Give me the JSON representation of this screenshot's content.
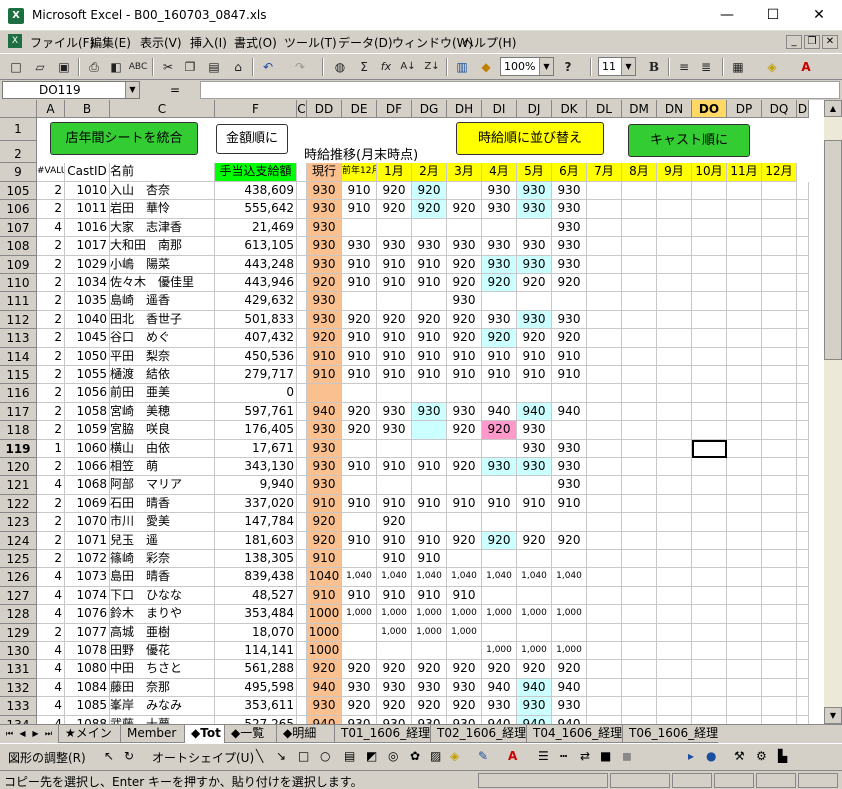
{
  "window": {
    "title": "Microsoft Excel - B00_160703_0847.xls",
    "minimize": "—",
    "maximize": "☐",
    "close": "✕",
    "app_icon": "X"
  },
  "menu": [
    "ファイル(F)",
    "編集(E)",
    "表示(V)",
    "挿入(I)",
    "書式(O)",
    "ツール(T)",
    "データ(D)",
    "ウィンドウ(W)",
    "ヘルプ(H)"
  ],
  "mdi": {
    "min": "_",
    "restore": "❐",
    "close": "✕"
  },
  "toolbar": {
    "zoom": "100%",
    "font_size": "11",
    "bold": "B",
    "icons": [
      "new-icon",
      "open-icon",
      "save-icon",
      "print-icon",
      "preview-icon",
      "spell-icon",
      "cut-icon",
      "copy-icon",
      "paste-icon",
      "format-painter-icon",
      "undo-icon",
      "redo-icon",
      "hyperlink-icon",
      "autosum-icon",
      "function-icon",
      "sort-asc-icon",
      "sort-desc-icon",
      "chart-icon",
      "drawing-icon",
      "help-icon",
      "align-center-icon",
      "align-right-icon",
      "borders-icon",
      "fill-color-icon",
      "font-color-icon"
    ],
    "sum_glyph": "Σ",
    "fx_glyph": "fx",
    "az_glyph": "A↓",
    "za_glyph": "Z↓",
    "help_glyph": "?",
    "font_color_glyph": "A"
  },
  "formula_bar": {
    "name_box": "DO119",
    "fx": "=",
    "value": ""
  },
  "columns": [
    {
      "id": "A",
      "label": "A",
      "w": 28
    },
    {
      "id": "B",
      "label": "B",
      "w": 45
    },
    {
      "id": "C",
      "label": "C",
      "w": 105
    },
    {
      "id": "F",
      "label": "F",
      "w": 82
    },
    {
      "id": "C2",
      "label": "C",
      "w": 10
    },
    {
      "id": "DD",
      "label": "DD",
      "w": 35
    },
    {
      "id": "DE",
      "label": "DE",
      "w": 35
    },
    {
      "id": "DF",
      "label": "DF",
      "w": 35
    },
    {
      "id": "DG",
      "label": "DG",
      "w": 35
    },
    {
      "id": "DH",
      "label": "DH",
      "w": 35
    },
    {
      "id": "DI",
      "label": "DI",
      "w": 35
    },
    {
      "id": "DJ",
      "label": "DJ",
      "w": 35
    },
    {
      "id": "DK",
      "label": "DK",
      "w": 35
    },
    {
      "id": "DL",
      "label": "DL",
      "w": 35
    },
    {
      "id": "DM",
      "label": "DM",
      "w": 35
    },
    {
      "id": "DN",
      "label": "DN",
      "w": 35
    },
    {
      "id": "DO",
      "label": "DO",
      "w": 35
    },
    {
      "id": "DP",
      "label": "DP",
      "w": 35
    },
    {
      "id": "DQ",
      "label": "DQ",
      "w": 35
    },
    {
      "id": "DR",
      "label": "D",
      "w": 12
    }
  ],
  "buttons": {
    "merge": "店年間シートを統合",
    "amount_order": "金額順に",
    "wage_order": "時給順に並び替え",
    "cast_order": "キャスト順に"
  },
  "header_rows": {
    "row1": "1",
    "row2": "2",
    "row9": "9",
    "title": "時給推移(月末時点)",
    "value_tag": "#VALUE!",
    "cast_id": "CastID",
    "name": "名前",
    "allowance": "手当込支給額",
    "current": "現行",
    "prev_dec": "前年12月",
    "months": [
      "1月",
      "2月",
      "3月",
      "4月",
      "5月",
      "6月",
      "7月",
      "8月",
      "9月",
      "10月",
      "11月",
      "12月"
    ]
  },
  "rows": [
    {
      "n": "105",
      "a": "2",
      "b": "1010",
      "c": "入山　杏奈",
      "f": "438,609",
      "dd": "930",
      "m": [
        "910",
        "920",
        "920",
        "",
        "930",
        "930",
        "930"
      ],
      "hl": [
        2,
        5
      ]
    },
    {
      "n": "106",
      "a": "2",
      "b": "1011",
      "c": "岩田　華怜",
      "f": "555,642",
      "dd": "930",
      "m": [
        "910",
        "920",
        "920",
        "920",
        "930",
        "930",
        "930"
      ],
      "hl": [
        2,
        5
      ]
    },
    {
      "n": "107",
      "a": "4",
      "b": "1016",
      "c": "大家　志津香",
      "f": "21,469",
      "dd": "930",
      "m": [
        "",
        "",
        "",
        "",
        "",
        "",
        "930"
      ],
      "hl": []
    },
    {
      "n": "108",
      "a": "2",
      "b": "1017",
      "c": "大和田　南那",
      "f": "613,105",
      "dd": "930",
      "m": [
        "930",
        "930",
        "930",
        "930",
        "930",
        "930",
        "930"
      ],
      "hl": []
    },
    {
      "n": "109",
      "a": "2",
      "b": "1029",
      "c": "小嶋　陽菜",
      "f": "443,248",
      "dd": "930",
      "m": [
        "910",
        "910",
        "910",
        "920",
        "930",
        "930",
        "930"
      ],
      "hl": [
        4,
        5
      ]
    },
    {
      "n": "110",
      "a": "2",
      "b": "1034",
      "c": "佐々木　優佳里",
      "f": "443,946",
      "dd": "920",
      "m": [
        "910",
        "910",
        "910",
        "920",
        "920",
        "920",
        "920"
      ],
      "hl": [
        4
      ]
    },
    {
      "n": "111",
      "a": "2",
      "b": "1035",
      "c": "島崎　遥香",
      "f": "429,632",
      "dd": "930",
      "m": [
        "",
        "",
        "",
        "930",
        "",
        "",
        ""
      ],
      "hl": []
    },
    {
      "n": "112",
      "a": "2",
      "b": "1040",
      "c": "田北　香世子",
      "f": "501,833",
      "dd": "930",
      "m": [
        "920",
        "920",
        "920",
        "920",
        "930",
        "930",
        "930"
      ],
      "hl": [
        5
      ]
    },
    {
      "n": "113",
      "a": "2",
      "b": "1045",
      "c": "谷口　めぐ",
      "f": "407,432",
      "dd": "920",
      "m": [
        "910",
        "910",
        "910",
        "920",
        "920",
        "920",
        "920"
      ],
      "hl": [
        4
      ]
    },
    {
      "n": "114",
      "a": "2",
      "b": "1050",
      "c": "平田　梨奈",
      "f": "450,536",
      "dd": "910",
      "m": [
        "910",
        "910",
        "910",
        "910",
        "910",
        "910",
        "910"
      ],
      "hl": []
    },
    {
      "n": "115",
      "a": "2",
      "b": "1055",
      "c": "樋渡　結依",
      "f": "279,717",
      "dd": "910",
      "m": [
        "910",
        "910",
        "910",
        "910",
        "910",
        "910",
        "910"
      ],
      "hl": []
    },
    {
      "n": "116",
      "a": "2",
      "b": "1056",
      "c": "前田　亜美",
      "f": "0",
      "dd": "",
      "m": [
        "",
        "",
        "",
        "",
        "",
        "",
        ""
      ],
      "hl": []
    },
    {
      "n": "117",
      "a": "2",
      "b": "1058",
      "c": "宮崎　美穂",
      "f": "597,761",
      "dd": "940",
      "m": [
        "920",
        "930",
        "930",
        "930",
        "940",
        "940",
        "940"
      ],
      "hl": [
        2,
        5
      ]
    },
    {
      "n": "118",
      "a": "2",
      "b": "1059",
      "c": "宮脇　咲良",
      "f": "176,405",
      "dd": "930",
      "m": [
        "920",
        "930",
        "",
        "920",
        "920",
        "930",
        ""
      ],
      "hl": [
        2
      ],
      "pink": [
        4
      ]
    },
    {
      "n": "119",
      "a": "1",
      "b": "1060",
      "c": "横山　由依",
      "f": "17,671",
      "dd": "930",
      "m": [
        "",
        "",
        "",
        "",
        "",
        "930",
        "930"
      ],
      "hl": []
    },
    {
      "n": "120",
      "a": "2",
      "b": "1066",
      "c": "相笠　萌",
      "f": "343,130",
      "dd": "930",
      "m": [
        "910",
        "910",
        "910",
        "920",
        "930",
        "930",
        "930"
      ],
      "hl": [
        4,
        5
      ]
    },
    {
      "n": "121",
      "a": "4",
      "b": "1068",
      "c": "阿部　マリア",
      "f": "9,940",
      "dd": "930",
      "m": [
        "",
        "",
        "",
        "",
        "",
        "",
        "930"
      ],
      "hl": []
    },
    {
      "n": "122",
      "a": "2",
      "b": "1069",
      "c": "石田　晴香",
      "f": "337,020",
      "dd": "910",
      "m": [
        "910",
        "910",
        "910",
        "910",
        "910",
        "910",
        "910"
      ],
      "hl": []
    },
    {
      "n": "123",
      "a": "2",
      "b": "1070",
      "c": "市川　愛美",
      "f": "147,784",
      "dd": "920",
      "m": [
        "",
        "920",
        "",
        "",
        "",
        "",
        ""
      ],
      "hl": []
    },
    {
      "n": "124",
      "a": "2",
      "b": "1071",
      "c": "兒玉　遥",
      "f": "181,603",
      "dd": "920",
      "m": [
        "910",
        "910",
        "910",
        "920",
        "920",
        "920",
        "920"
      ],
      "hl": [
        4
      ]
    },
    {
      "n": "125",
      "a": "2",
      "b": "1072",
      "c": "篠崎　彩奈",
      "f": "138,305",
      "dd": "910",
      "m": [
        "",
        "910",
        "910",
        "",
        "",
        "",
        ""
      ],
      "hl": []
    },
    {
      "n": "126",
      "a": "4",
      "b": "1073",
      "c": "島田　晴香",
      "f": "839,438",
      "dd": "1040",
      "m": [
        "1,040",
        "1,040",
        "1,040",
        "1,040",
        "1,040",
        "1,040",
        "1,040"
      ],
      "hl": [],
      "small": true
    },
    {
      "n": "127",
      "a": "4",
      "b": "1074",
      "c": "下口　ひなな",
      "f": "48,527",
      "dd": "910",
      "m": [
        "910",
        "910",
        "910",
        "910",
        "",
        "",
        ""
      ],
      "hl": []
    },
    {
      "n": "128",
      "a": "4",
      "b": "1076",
      "c": "鈴木　まりや",
      "f": "353,484",
      "dd": "1000",
      "m": [
        "1,000",
        "1,000",
        "1,000",
        "1,000",
        "1,000",
        "1,000",
        "1,000"
      ],
      "hl": [],
      "small": true
    },
    {
      "n": "129",
      "a": "2",
      "b": "1077",
      "c": "高城　亜樹",
      "f": "18,070",
      "dd": "1000",
      "m": [
        "",
        "1,000",
        "1,000",
        "1,000",
        "",
        "",
        ""
      ],
      "hl": [],
      "small": true
    },
    {
      "n": "130",
      "a": "4",
      "b": "1078",
      "c": "田野　優花",
      "f": "114,141",
      "dd": "1000",
      "m": [
        "",
        "",
        "",
        "",
        "1,000",
        "1,000",
        "1,000"
      ],
      "hl": [],
      "small": true
    },
    {
      "n": "131",
      "a": "4",
      "b": "1080",
      "c": "中田　ちさと",
      "f": "561,288",
      "dd": "920",
      "m": [
        "920",
        "920",
        "920",
        "920",
        "920",
        "920",
        "920"
      ],
      "hl": []
    },
    {
      "n": "132",
      "a": "4",
      "b": "1084",
      "c": "藤田　奈那",
      "f": "495,598",
      "dd": "940",
      "m": [
        "930",
        "930",
        "930",
        "930",
        "940",
        "940",
        "940"
      ],
      "hl": [
        5
      ]
    },
    {
      "n": "133",
      "a": "4",
      "b": "1085",
      "c": "峯岸　みなみ",
      "f": "353,611",
      "dd": "930",
      "m": [
        "920",
        "920",
        "920",
        "920",
        "930",
        "930",
        "930"
      ],
      "hl": [
        5
      ]
    },
    {
      "n": "134",
      "a": "4",
      "b": "1088",
      "c": "武藤　十夢",
      "f": "527,265",
      "dd": "940",
      "m": [
        "930",
        "930",
        "930",
        "930",
        "940",
        "940",
        "940"
      ],
      "hl": [
        5
      ]
    }
  ],
  "tabs": [
    "★メイン",
    "Member",
    "◆Tot",
    "◆一覧",
    "◆明細",
    "T01_1606_経理",
    "T02_1606_経理",
    "T04_1606_経理",
    "T06_1606_経理"
  ],
  "drawbar": {
    "adjust": "図形の調整(R)",
    "autoshape": "オートシェイプ(U)"
  },
  "status": "コピー先を選択し、Enter キーを押すか、貼り付けを選択します。",
  "colors": {
    "green_btn": "#33cc33",
    "yellow_btn": "#ffff00",
    "orange_col": "#fac090",
    "green_hdr": "#00ff00",
    "yellow_hdr": "#ffff00",
    "cyan": "#ccffff",
    "pink": "#ff99cc"
  }
}
